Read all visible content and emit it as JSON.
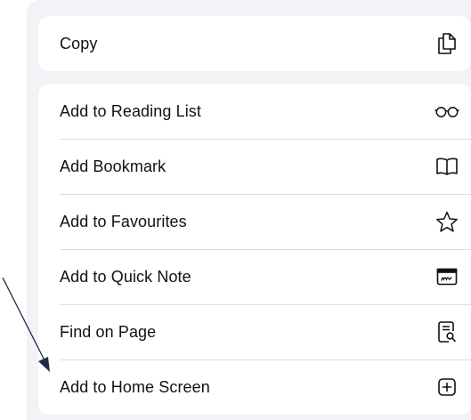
{
  "menu": {
    "copy_group": [
      {
        "label": "Copy",
        "icon": "copy-icon"
      }
    ],
    "actions": [
      {
        "label": "Add to Reading List",
        "icon": "glasses-icon"
      },
      {
        "label": "Add Bookmark",
        "icon": "book-icon"
      },
      {
        "label": "Add to Favourites",
        "icon": "star-icon"
      },
      {
        "label": "Add to Quick Note",
        "icon": "quick-note-icon"
      },
      {
        "label": "Find on Page",
        "icon": "find-document-icon"
      },
      {
        "label": "Add to Home Screen",
        "icon": "plus-square-icon"
      }
    ]
  }
}
